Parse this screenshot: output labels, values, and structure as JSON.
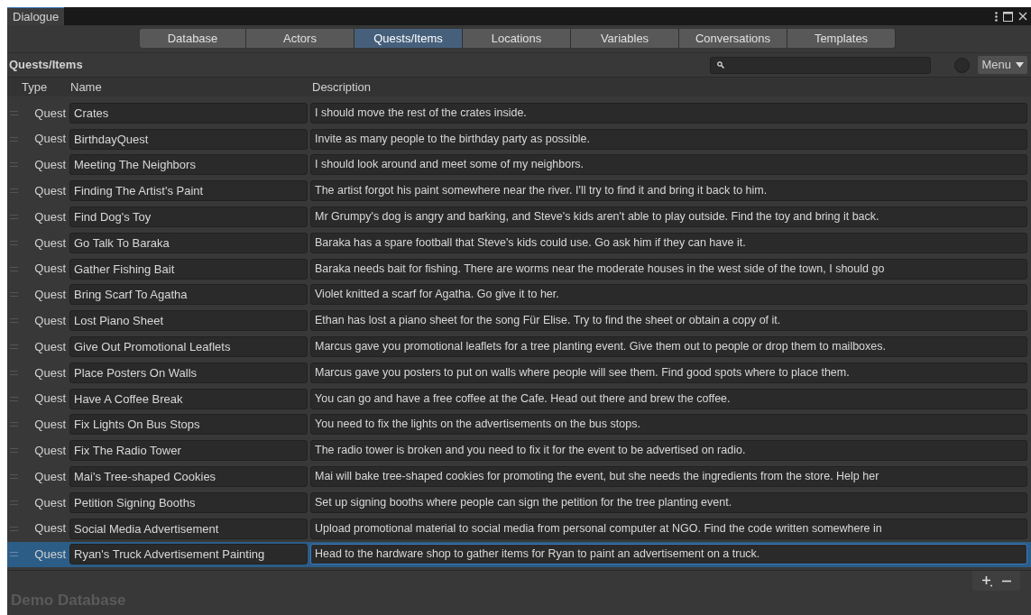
{
  "window": {
    "title": "Dialogue"
  },
  "tabs": [
    {
      "label": "Database",
      "selected": false
    },
    {
      "label": "Actors",
      "selected": false
    },
    {
      "label": "Quests/Items",
      "selected": true
    },
    {
      "label": "Locations",
      "selected": false
    },
    {
      "label": "Variables",
      "selected": false
    },
    {
      "label": "Conversations",
      "selected": false
    },
    {
      "label": "Templates",
      "selected": false
    }
  ],
  "section_title": "Quests/Items",
  "menu_button": "Menu",
  "table": {
    "columns": [
      "Type",
      "Name",
      "Description"
    ],
    "rows": [
      {
        "type": "Quest",
        "name": "Crates",
        "description": "I should move the rest of the crates inside.",
        "selected": false
      },
      {
        "type": "Quest",
        "name": "BirthdayQuest",
        "description": "Invite as many people to the birthday party as possible.",
        "selected": false
      },
      {
        "type": "Quest",
        "name": "Meeting The Neighbors",
        "description": "I should look around and meet some of my neighbors.",
        "selected": false
      },
      {
        "type": "Quest",
        "name": "Finding The Artist's Paint",
        "description": "The artist forgot his paint somewhere near the river. I'll try to find it and bring it back to him.",
        "selected": false
      },
      {
        "type": "Quest",
        "name": "Find Dog's Toy",
        "description": "Mr Grumpy's dog is angry and barking, and Steve's kids aren't able to play outside. Find the toy and bring it back.",
        "selected": false
      },
      {
        "type": "Quest",
        "name": "Go Talk To Baraka",
        "description": "Baraka has a spare football that Steve's kids could use. Go ask him if they can have it.",
        "selected": false
      },
      {
        "type": "Quest",
        "name": "Gather Fishing Bait",
        "description": "Baraka needs bait for fishing. There are worms near the moderate houses in the west side of the town, I should go",
        "selected": false
      },
      {
        "type": "Quest",
        "name": "Bring Scarf To Agatha",
        "description": "Violet knitted a scarf for Agatha. Go give it to her.",
        "selected": false
      },
      {
        "type": "Quest",
        "name": "Lost Piano Sheet",
        "description": "Ethan has lost a piano sheet for the song Für Elise. Try to find the sheet or obtain a copy of it.",
        "selected": false
      },
      {
        "type": "Quest",
        "name": "Give Out Promotional Leaflets",
        "description": "Marcus gave you promotional leaflets for a tree planting event. Give them out to people or drop them to mailboxes.",
        "selected": false
      },
      {
        "type": "Quest",
        "name": "Place Posters On Walls",
        "description": "Marcus gave you posters to put on walls where people will see them. Find good spots where to place them.",
        "selected": false
      },
      {
        "type": "Quest",
        "name": "Have A Coffee Break",
        "description": "You can go and have a free coffee at the Cafe. Head out there and brew the coffee.",
        "selected": false
      },
      {
        "type": "Quest",
        "name": "Fix Lights On Bus Stops",
        "description": "You need to fix the lights on the advertisements on the bus stops.",
        "selected": false
      },
      {
        "type": "Quest",
        "name": "Fix The Radio Tower",
        "description": "The radio tower is broken and you need to fix it for the event to be advertised on radio.",
        "selected": false
      },
      {
        "type": "Quest",
        "name": "Mai's Tree-shaped Cookies",
        "description": "Mai will bake tree-shaped cookies for promoting the event, but she needs the ingredients from the store. Help her",
        "selected": false
      },
      {
        "type": "Quest",
        "name": "Petition Signing Booths",
        "description": "Set up signing booths where people can sign the petition for the tree planting event.",
        "selected": false
      },
      {
        "type": "Quest",
        "name": "Social Media Advertisement",
        "description": "Upload promotional material to social media from personal computer at NGO. Find the code written somewhere in",
        "selected": false
      },
      {
        "type": "Quest",
        "name": "Ryan's Truck Advertisement Painting",
        "description": "Head to the hardware shop to gather items for Ryan to paint an advertisement on a truck.",
        "selected": true
      }
    ]
  },
  "footer_title": "Demo Database"
}
